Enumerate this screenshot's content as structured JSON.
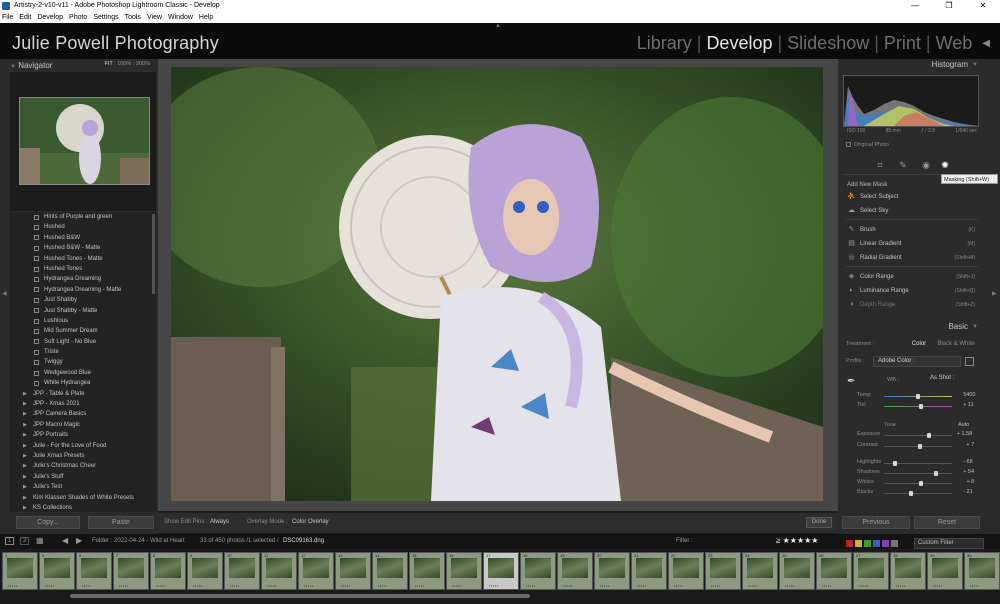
{
  "window": {
    "title": "Artistry-2-v10-v11 - Adobe Photoshop Lightroom Classic - Develop",
    "controls": [
      "—",
      "❐",
      "✕"
    ]
  },
  "menu": [
    "File",
    "Edit",
    "Develop",
    "Photo",
    "Settings",
    "Tools",
    "View",
    "Window",
    "Help"
  ],
  "identity_plate": "Julie Powell Photography",
  "modules": [
    {
      "label": "Library",
      "active": false
    },
    {
      "label": "Develop",
      "active": true
    },
    {
      "label": "Slideshow",
      "active": false
    },
    {
      "label": "Print",
      "active": false
    },
    {
      "label": "Web",
      "active": false
    }
  ],
  "navigator": {
    "title": "Navigator",
    "zoom_options": [
      "FIT",
      "100%",
      "200%"
    ]
  },
  "presets": {
    "items": [
      {
        "label": "Hints of Purple and green",
        "type": "preset"
      },
      {
        "label": "Hushed",
        "type": "preset"
      },
      {
        "label": "Hushed B&W",
        "type": "preset"
      },
      {
        "label": "Hushed B&W - Matte",
        "type": "preset"
      },
      {
        "label": "Hushed Tones - Matte",
        "type": "preset"
      },
      {
        "label": "Hushed Tones",
        "type": "preset"
      },
      {
        "label": "Hydrangea Dreaming",
        "type": "preset"
      },
      {
        "label": "Hydrangea Dreaming - Matte",
        "type": "preset"
      },
      {
        "label": "Just Shabby",
        "type": "preset"
      },
      {
        "label": "Just Shabby - Matte",
        "type": "preset"
      },
      {
        "label": "Lushious",
        "type": "preset"
      },
      {
        "label": "Mid Summer Dream",
        "type": "preset"
      },
      {
        "label": "Soft Light - No Blue",
        "type": "preset"
      },
      {
        "label": "Triste",
        "type": "preset"
      },
      {
        "label": "Twiggy",
        "type": "preset"
      },
      {
        "label": "Wedgewood Blue",
        "type": "preset"
      },
      {
        "label": "White Hydrangea",
        "type": "preset"
      },
      {
        "label": "JPP - Table & Plate",
        "type": "group"
      },
      {
        "label": "JPP - Xmas 2021",
        "type": "group"
      },
      {
        "label": "JPP Camera Basics",
        "type": "group"
      },
      {
        "label": "JPP Macro Magic",
        "type": "group"
      },
      {
        "label": "JPP Portraits",
        "type": "group"
      },
      {
        "label": "Julie - For the Love of Food",
        "type": "group"
      },
      {
        "label": "Julie Xmas Presets",
        "type": "group"
      },
      {
        "label": "Julie's Christmas Cheer",
        "type": "group"
      },
      {
        "label": "Julie's Stuff",
        "type": "group"
      },
      {
        "label": "Julie's Test",
        "type": "group"
      },
      {
        "label": "Kim Klassen Shades of White Presets",
        "type": "group"
      },
      {
        "label": "KS Collections",
        "type": "group"
      }
    ]
  },
  "left_buttons": {
    "copy": "Copy...",
    "paste": "Paste"
  },
  "toolbar": {
    "show_edit_pins_label": "Show Edit Pins :",
    "show_edit_pins_value": "Always",
    "overlay_mode_label": "Overlay Mode :",
    "overlay_mode_value": "Color Overlay",
    "done": "Done"
  },
  "histogram": {
    "title": "Histogram",
    "exif": [
      "ISO 100",
      "85 mm",
      "ƒ / 2.8",
      "1/640 sec"
    ],
    "original_photo": "Original Photo"
  },
  "masking": {
    "tooltip": "Masking (Shift+W)",
    "header": "Add New Mask",
    "rows": [
      {
        "icon": "⛹",
        "label": "Select Subject",
        "key": "",
        "dim": false
      },
      {
        "icon": "☁",
        "label": "Select Sky",
        "key": "",
        "dim": false
      },
      {
        "icon": "✎",
        "label": "Brush",
        "key": "(K)",
        "dim": false
      },
      {
        "icon": "▤",
        "label": "Linear Gradient",
        "key": "(M)",
        "dim": false
      },
      {
        "icon": "◎",
        "label": "Radial Gradient",
        "key": "(Shift+M)",
        "dim": false
      },
      {
        "icon": "◈",
        "label": "Color Range",
        "key": "(Shift+J)",
        "dim": false
      },
      {
        "icon": "◐",
        "label": "Luminance Range",
        "key": "(Shift+Q)",
        "dim": false
      },
      {
        "icon": "◑",
        "label": "Depth Range",
        "key": "(Shift+Z)",
        "dim": true
      }
    ]
  },
  "basic": {
    "title": "Basic",
    "treatment_label": "Treatment :",
    "treatment_color": "Color",
    "treatment_bw": "Black & White",
    "profile_label": "Profile :",
    "profile_value": "Adobe Color :",
    "wb_label": "WB :",
    "wb_value": "As Shot :",
    "tone_label": "Tone",
    "auto": "Auto",
    "sliders": [
      {
        "name": "Temp",
        "value": "5400",
        "pos": 0.5,
        "group": "wb"
      },
      {
        "name": "Tint",
        "value": "+ 11",
        "pos": 0.55,
        "group": "wb"
      },
      {
        "name": "Exposure",
        "value": "+ 1.58",
        "pos": 0.66,
        "group": "tone"
      },
      {
        "name": "Contrast",
        "value": "+ 7",
        "pos": 0.53,
        "group": "tone"
      },
      {
        "name": "Highlights",
        "value": "- 68",
        "pos": 0.16,
        "group": "presence"
      },
      {
        "name": "Shadows",
        "value": "+ 54",
        "pos": 0.77,
        "group": "presence"
      },
      {
        "name": "Whites",
        "value": "+ 8",
        "pos": 0.54,
        "group": "presence"
      },
      {
        "name": "Blacks",
        "value": "- 21",
        "pos": 0.4,
        "group": "presence"
      }
    ]
  },
  "right_buttons": {
    "previous": "Previous",
    "reset": "Reset"
  },
  "filmstrip": {
    "views": [
      "1",
      "2"
    ],
    "folder": "Folder : 2022-04-24 - Wild at Heart",
    "count": "33 of 450 photos /1 selected /",
    "filename": "DSC09163.dng",
    "filter_label": "Filter :",
    "rating_filter": "≥ ★★★★★",
    "custom_filter": "Custom Filter",
    "selected_index": 13,
    "cells": [
      {
        "num": "4"
      },
      {
        "num": "5"
      },
      {
        "num": "6"
      },
      {
        "num": "7"
      },
      {
        "num": "8"
      },
      {
        "num": "9"
      },
      {
        "num": "10"
      },
      {
        "num": "11"
      },
      {
        "num": "12"
      },
      {
        "num": "13"
      },
      {
        "num": "14"
      },
      {
        "num": "15"
      },
      {
        "num": "16"
      },
      {
        "num": "17"
      },
      {
        "num": "18"
      },
      {
        "num": "19"
      },
      {
        "num": "20"
      },
      {
        "num": "21"
      },
      {
        "num": "22"
      },
      {
        "num": "23"
      },
      {
        "num": "24"
      },
      {
        "num": "25"
      },
      {
        "num": "26"
      },
      {
        "num": "27"
      },
      {
        "num": "28"
      },
      {
        "num": "29"
      },
      {
        "num": "30"
      }
    ],
    "swatch_colors": [
      "#b32626",
      "#c9b52b",
      "#3f9a3f",
      "#3a5fb8",
      "#8a3fa8",
      "#777777"
    ]
  },
  "colors": {
    "accent_active": "#e4e4e4",
    "panel": "#2b2b2b",
    "background": "#1e1e1e"
  }
}
